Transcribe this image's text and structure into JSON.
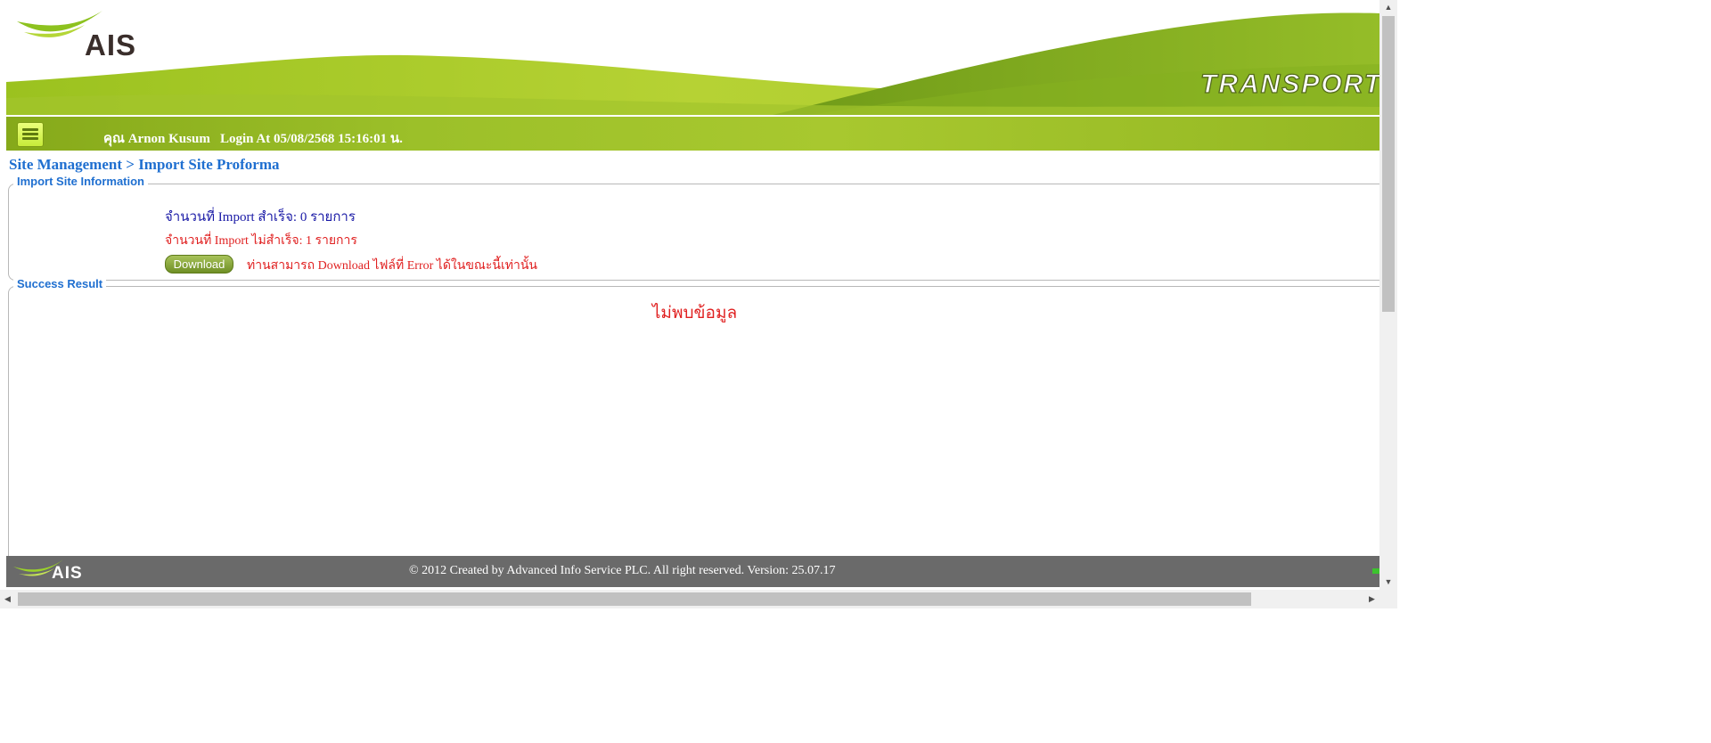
{
  "header": {
    "logo_text": "AIS",
    "tagline": "TRANSPORT",
    "colors": {
      "green_light": "#c5dc4a",
      "green_mid": "#a8c82f",
      "green_dark": "#6d9a17"
    }
  },
  "navbar": {
    "menu_icon": "hamburger-icon",
    "user": "คุณ Arnon Kusum",
    "login": "Login At 05/08/2568 15:16:01 น."
  },
  "breadcrumb": "Site Management > Import Site Proforma",
  "import_info": {
    "legend": "Import Site Information",
    "success_line": "จำนวนที่ Import สำเร็จ: 0 รายการ",
    "fail_line": "จำนวนที่ Import ไม่สำเร็จ: 1 รายการ",
    "download_label": "Download",
    "download_note": "ท่านสามารถ Download ไฟล์ที่ Error ได้ในขณะนี้เท่านั้น"
  },
  "success_result": {
    "legend": "Success Result",
    "empty_message": "ไม่พบข้อมูล"
  },
  "footer": {
    "logo_text": "AIS",
    "copyright": "© 2012 Created by Advanced Info Service PLC.  All right reserved.   Version: 25.07.17"
  }
}
